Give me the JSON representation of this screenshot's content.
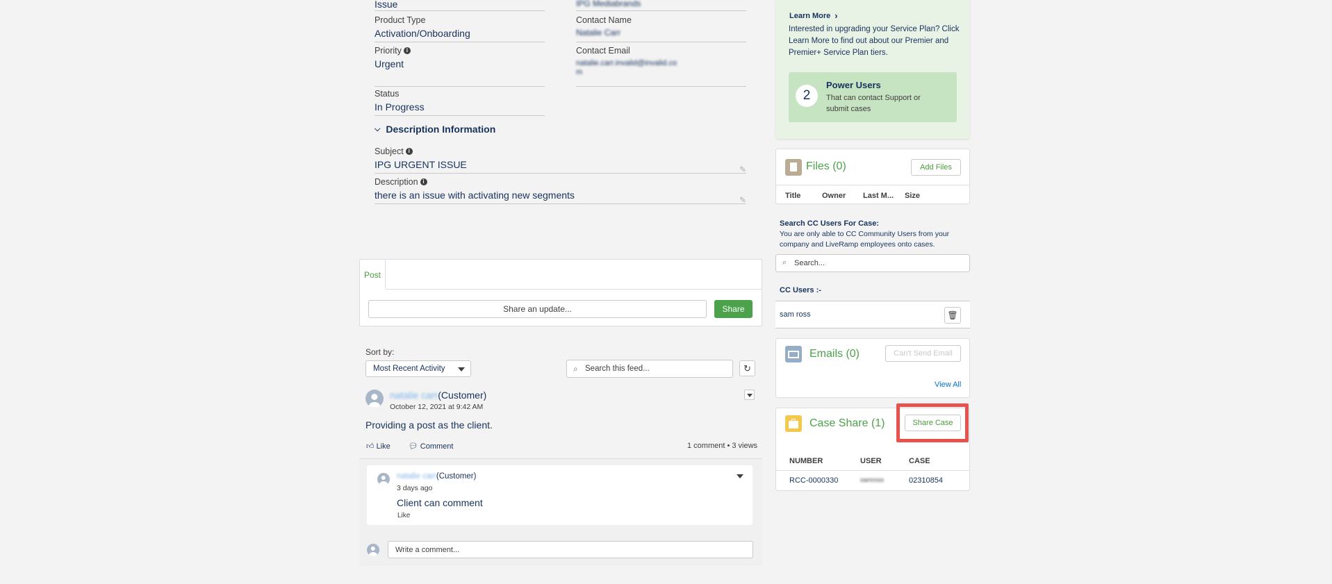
{
  "details": {
    "issue_label": "Issue",
    "issue_right_value": "IPG Mediabrands",
    "product_type_label": "Product Type",
    "product_type_value": "Activation/Onboarding",
    "contact_name_label": "Contact Name",
    "contact_name_value": "Natalie Carr",
    "priority_label": "Priority",
    "priority_value": "Urgent",
    "contact_email_label": "Contact Email",
    "contact_email_value": "natalie.carr.invalid@invalid.co",
    "contact_email_value2": "m",
    "status_label": "Status",
    "status_value": "In Progress"
  },
  "description_section": {
    "header": "Description Information",
    "subject_label": "Subject",
    "subject_value": "IPG URGENT ISSUE",
    "description_label": "Description",
    "description_value": "there is an issue with activating new segments"
  },
  "publisher": {
    "tab_label": "Post",
    "share_placeholder": "Share an update...",
    "share_button": "Share"
  },
  "feed": {
    "sort_label": "Sort by:",
    "sort_value": "Most Recent Activity",
    "search_placeholder": "Search this feed...",
    "refresh_icon": "↻",
    "post": {
      "author": "natalie carr",
      "author_role": "(Customer)",
      "time": "October 12, 2021 at 9:42 AM",
      "body": "Providing a post as the client.",
      "like_label": "Like",
      "comment_label": "Comment",
      "stats": "1 comment  •  3 views"
    },
    "comment": {
      "author": "natalie carr",
      "author_role": "(Customer)",
      "time": "3 days ago",
      "body": "Client can comment",
      "like_label": "Like"
    },
    "write_comment_placeholder": "Write a comment..."
  },
  "promo": {
    "learn_more": "Learn More",
    "text": "Interested in upgrading your Service Plan? Click Learn More to find out about our Premier and Premier+ Service Plan tiers.",
    "power_count": "2",
    "power_title": "Power Users",
    "power_sub": "That can contact Support or submit cases"
  },
  "files": {
    "title": "Files (0)",
    "add_button": "Add Files",
    "columns": [
      "Title",
      "Owner",
      "Last M...",
      "Size"
    ],
    "icon_color": "#baac93"
  },
  "cc_users": {
    "search_title": "Search CC Users For Case:",
    "search_desc": "You are only able to CC Community Users from your company and LiveRamp employees onto cases.",
    "search_placeholder": "Search...",
    "list_label": "CC Users :-",
    "users": [
      "sam ross"
    ]
  },
  "emails": {
    "title": "Emails (0)",
    "button": "Can't Send Email",
    "view_all": "View All",
    "icon_color": "#95aec5"
  },
  "case_share": {
    "title": "Case Share (1)",
    "button": "Share Case",
    "columns": [
      "NUMBER",
      "USER",
      "CASE"
    ],
    "rows": [
      {
        "number": "RCC-0000330",
        "user": "samross",
        "case": "02310854"
      }
    ],
    "icon_color": "#f4c84b",
    "highlight_color": "#e8514c"
  }
}
